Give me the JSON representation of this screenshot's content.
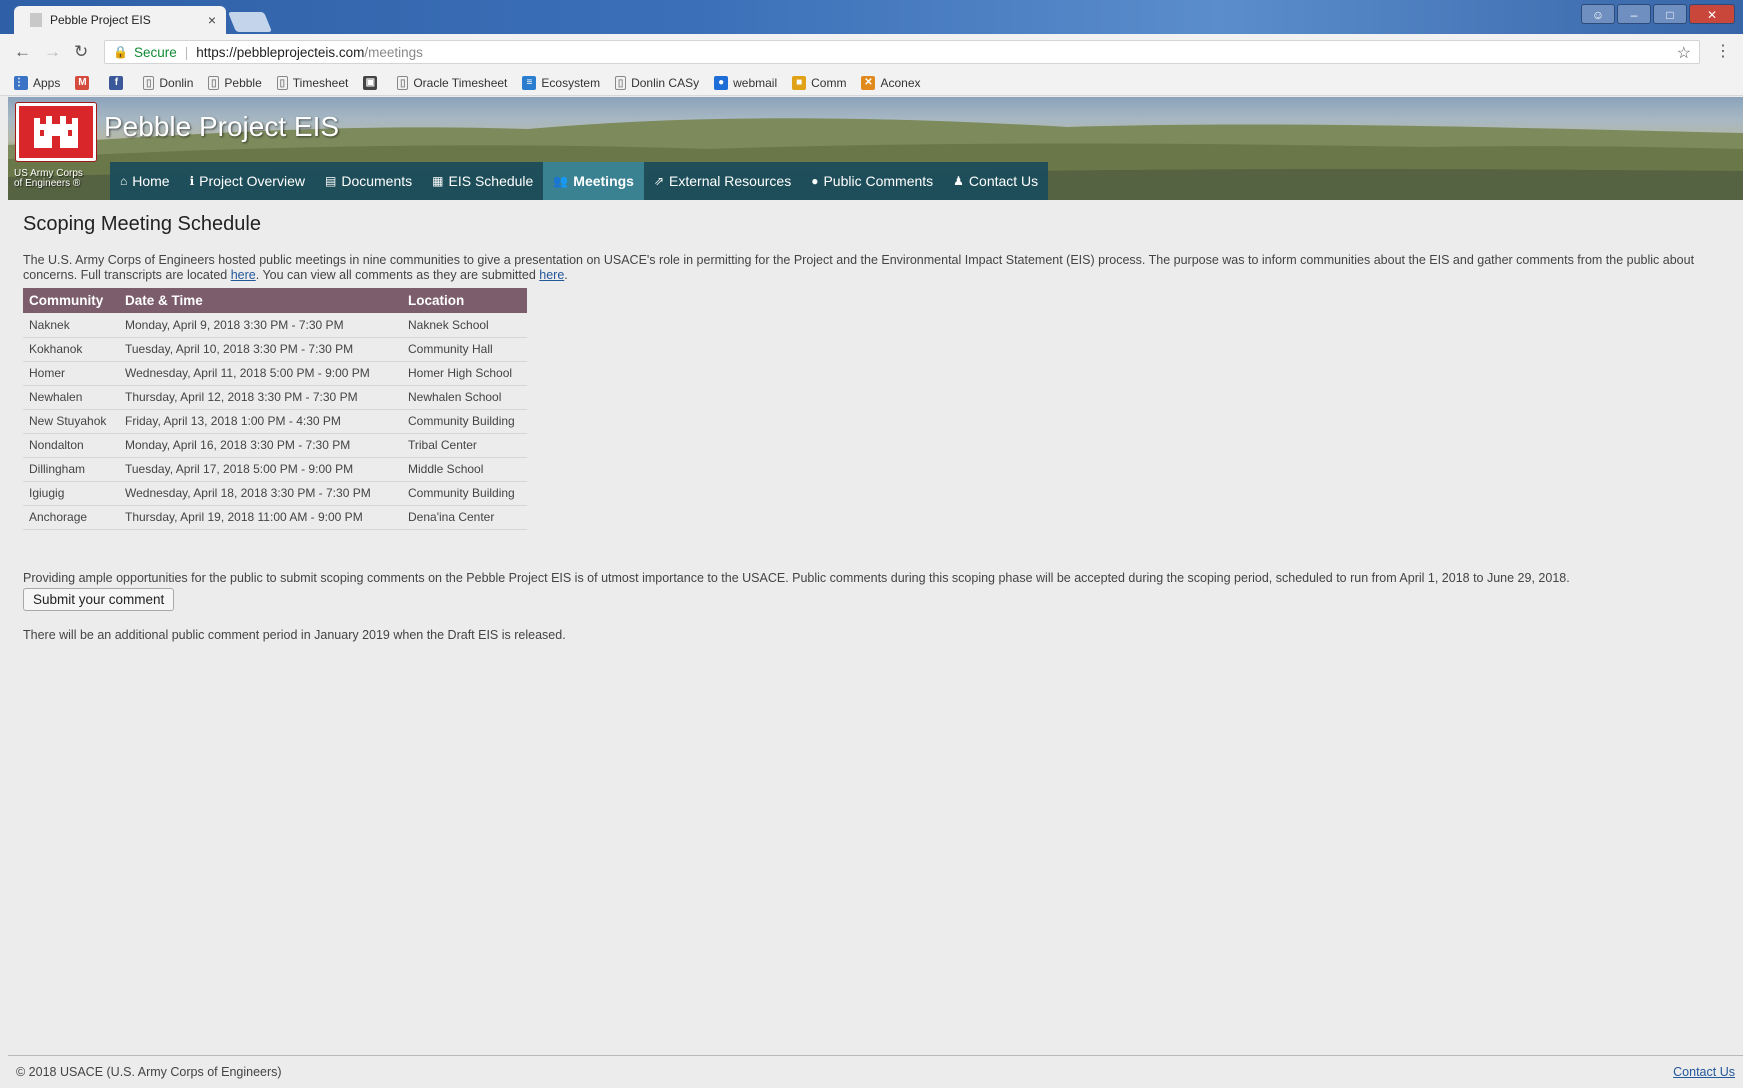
{
  "browser": {
    "tab_title": "Pebble Project EIS",
    "tab_close": "×",
    "secure_label": "Secure",
    "url_host": "https://pebbleprojecteis.com",
    "url_path": "/meetings",
    "bookmarks": [
      {
        "label": "Apps",
        "icon": "apps-grid-icon",
        "color": "#3b73c6"
      },
      {
        "label": "",
        "icon": "gmail-icon",
        "color": "#d54b3d"
      },
      {
        "label": "",
        "icon": "facebook-icon",
        "color": "#3b5998"
      },
      {
        "label": "Donlin",
        "icon": "page-icon",
        "color": "#888888"
      },
      {
        "label": "Pebble",
        "icon": "page-icon",
        "color": "#888888"
      },
      {
        "label": "Timesheet",
        "icon": "page-icon",
        "color": "#888888"
      },
      {
        "label": "",
        "icon": "app-icon",
        "color": "#444444"
      },
      {
        "label": "Oracle Timesheet",
        "icon": "page-icon",
        "color": "#888888"
      },
      {
        "label": "Ecosystem",
        "icon": "ecosystem-icon",
        "color": "#2b7dd0"
      },
      {
        "label": "Donlin CASy",
        "icon": "page-icon",
        "color": "#888888"
      },
      {
        "label": "webmail",
        "icon": "webmail-icon",
        "color": "#1d6ed6"
      },
      {
        "label": "Comm",
        "icon": "comm-icon",
        "color": "#e0a317"
      },
      {
        "label": "Aconex",
        "icon": "aconex-icon",
        "color": "#e08a1e"
      }
    ]
  },
  "site": {
    "title": "Pebble Project EIS",
    "corps_line1": "US Army Corps",
    "corps_line2": "of Engineers ®",
    "nav": [
      {
        "label": "Home",
        "icon": "home-icon",
        "glyph": "⌂"
      },
      {
        "label": "Project Overview",
        "icon": "info-icon",
        "glyph": "ℹ"
      },
      {
        "label": "Documents",
        "icon": "document-icon",
        "glyph": "▤"
      },
      {
        "label": "EIS Schedule",
        "icon": "calendar-icon",
        "glyph": "▦"
      },
      {
        "label": "Meetings",
        "icon": "group-icon",
        "glyph": "👥"
      },
      {
        "label": "External Resources",
        "icon": "external-link-icon",
        "glyph": "⇗"
      },
      {
        "label": "Public Comments",
        "icon": "comment-icon",
        "glyph": "●"
      },
      {
        "label": "Contact Us",
        "icon": "user-icon",
        "glyph": "♟"
      }
    ],
    "active_nav": "Meetings"
  },
  "main": {
    "title": "Scoping Meeting Schedule",
    "intro_a": "The U.S. Army Corps of Engineers hosted public meetings in nine communities to give a presentation on USACE's role in permitting for the Project and the Environmental Impact Statement (EIS) process. The purpose was to inform communities about the EIS and gather comments from the public about concerns. Full transcripts are located ",
    "intro_link1": "here",
    "intro_b": ". You can view all comments as they are submitted ",
    "intro_link2": "here",
    "intro_c": ".",
    "table": {
      "headers": [
        "Community",
        "Date & Time",
        "Location"
      ],
      "rows": [
        [
          "Naknek",
          "Monday, April 9, 2018 3:30 PM - 7:30 PM",
          "Naknek School"
        ],
        [
          "Kokhanok",
          "Tuesday, April 10, 2018 3:30 PM - 7:30 PM",
          "Community Hall"
        ],
        [
          "Homer",
          "Wednesday, April 11, 2018 5:00 PM - 9:00 PM",
          "Homer High School"
        ],
        [
          "Newhalen",
          "Thursday, April 12, 2018 3:30 PM - 7:30 PM",
          "Newhalen School"
        ],
        [
          "New Stuyahok",
          "Friday, April 13, 2018 1:00 PM - 4:30 PM",
          "Community Building"
        ],
        [
          "Nondalton",
          "Monday, April 16, 2018 3:30 PM - 7:30 PM",
          "Tribal Center"
        ],
        [
          "Dillingham",
          "Tuesday, April 17, 2018 5:00 PM - 9:00 PM",
          "Middle School"
        ],
        [
          "Igiugig",
          "Wednesday, April 18, 2018 3:30 PM - 7:30 PM",
          "Community Building"
        ],
        [
          "Anchorage",
          "Thursday, April 19, 2018 11:00 AM - 9:00 PM",
          "Dena'ina Center"
        ]
      ]
    },
    "para2": "Providing ample opportunities for the public to submit scoping comments on the Pebble Project EIS is of utmost importance to the USACE. Public comments during this scoping phase will be accepted during the scoping period, scheduled to run from April 1, 2018 to June 29, 2018.",
    "submit_label": "Submit your comment",
    "para3": "There will be an additional public comment period in January 2019 when the Draft EIS is released."
  },
  "footer": {
    "copyright": "© 2018 USACE (U.S. Army Corps of Engineers)",
    "contact": "Contact Us"
  },
  "colors": {
    "table_header": "#7c5d6b",
    "nav_bg": "#1a4c5c",
    "nav_active": "#3a8192",
    "logo_red": "#d8262a",
    "link": "#23589a"
  }
}
